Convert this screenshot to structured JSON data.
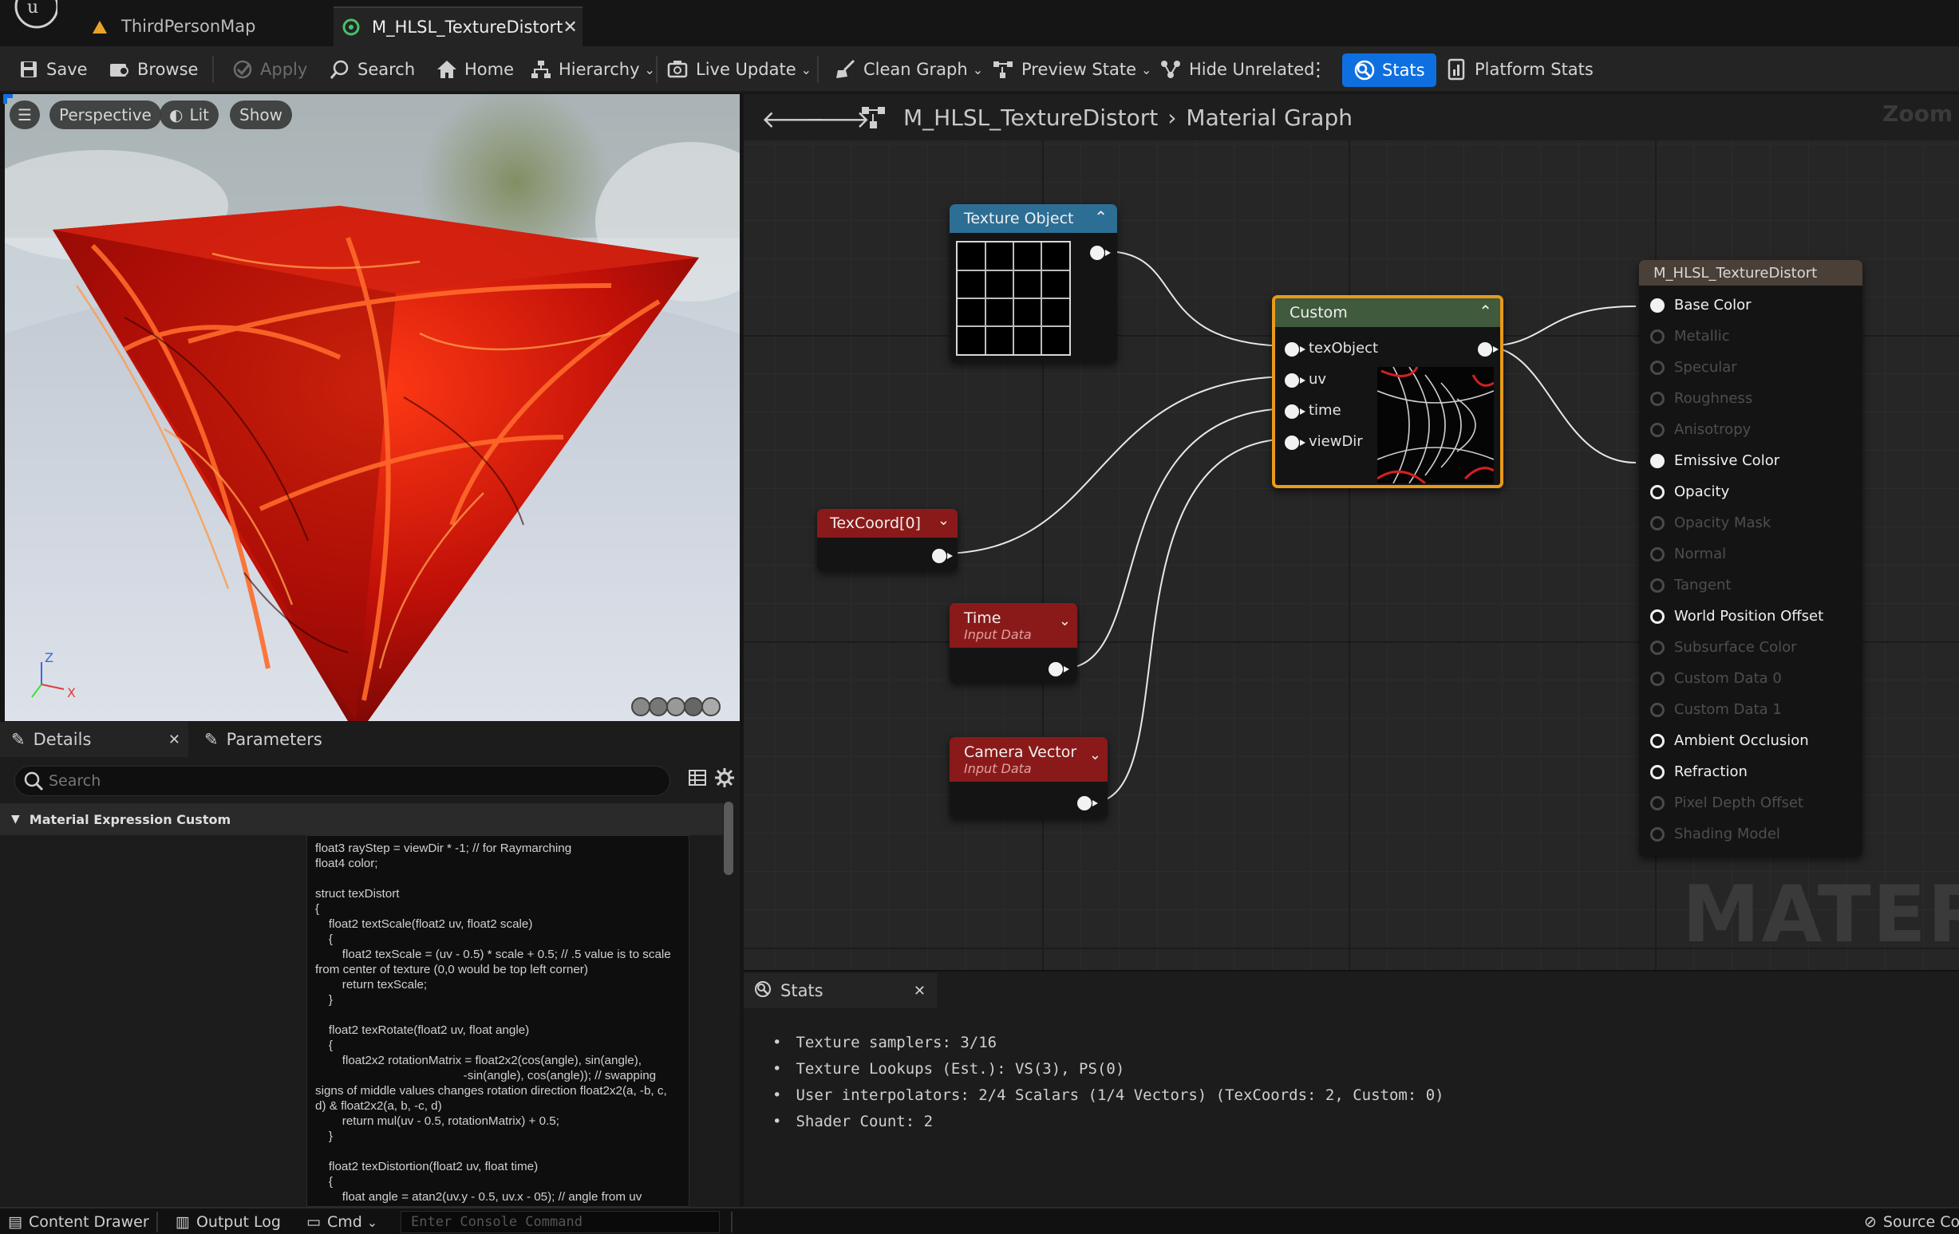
{
  "tabs": [
    {
      "label": "ThirdPersonMap",
      "icon": "map-icon"
    },
    {
      "label": "M_HLSL_TextureDistort",
      "icon": "material-icon",
      "active": true
    }
  ],
  "toolbar": {
    "save": "Save",
    "browse": "Browse",
    "apply": "Apply",
    "search": "Search",
    "home": "Home",
    "hierarchy": "Hierarchy",
    "live_update": "Live Update",
    "clean_graph": "Clean Graph",
    "preview_state": "Preview State",
    "hide_unrelated": "Hide Unrelated",
    "stats": "Stats",
    "platform_stats": "Platform Stats"
  },
  "viewport": {
    "perspective": "Perspective",
    "lit": "Lit",
    "show": "Show",
    "axis_x": "X",
    "axis_z": "Z"
  },
  "details": {
    "tab_details": "Details",
    "tab_parameters": "Parameters",
    "search_placeholder": "Search",
    "section": "Material Expression Custom",
    "code": "float3 rayStep = viewDir * -1; // for Raymarching\nfloat4 color;\n\nstruct texDistort\n{\n    float2 textScale(float2 uv, float2 scale)\n    {\n        float2 texScale = (uv - 0.5) * scale + 0.5; // .5 value is to scale from center of texture (0,0 would be top left corner)\n        return texScale;\n    }\n\n    float2 texRotate(float2 uv, float angle)\n    {\n        float2x2 rotationMatrix = float2x2(cos(angle), sin(angle),\n                                            -sin(angle), cos(angle)); // swapping signs of middle values changes rotation direction float2x2(a, -b, c, d) & float2x2(a, b, -c, d)\n        return mul(uv - 0.5, rotationMatrix) + 0.5;\n    }\n\n    float2 texDistortion(float2 uv, float time)\n    {\n        float angle = atan2(uv.y - 0.5, uv.x - 05); // angle from uv"
  },
  "graph": {
    "breadcrumb_asset": "M_HLSL_TextureDistort",
    "breadcrumb_graph": "Material Graph",
    "zoom": "Zoom",
    "watermark": "MATERIA",
    "nodes": {
      "texture_object": {
        "title": "Texture Object"
      },
      "custom": {
        "title": "Custom",
        "inputs": [
          "texObject",
          "uv",
          "time",
          "viewDir"
        ]
      },
      "texcoord": {
        "title": "TexCoord[0]"
      },
      "time": {
        "title": "Time",
        "subtitle": "Input Data"
      },
      "camera_vector": {
        "title": "Camera Vector",
        "subtitle": "Input Data"
      },
      "output": {
        "title": "M_HLSL_TextureDistort",
        "pins": [
          {
            "label": "Base Color",
            "active": true,
            "connected": true
          },
          {
            "label": "Metallic",
            "active": false
          },
          {
            "label": "Specular",
            "active": false
          },
          {
            "label": "Roughness",
            "active": false
          },
          {
            "label": "Anisotropy",
            "active": false
          },
          {
            "label": "Emissive Color",
            "active": true,
            "connected": true
          },
          {
            "label": "Opacity",
            "active": true
          },
          {
            "label": "Opacity Mask",
            "active": false
          },
          {
            "label": "Normal",
            "active": false
          },
          {
            "label": "Tangent",
            "active": false
          },
          {
            "label": "World Position Offset",
            "active": true
          },
          {
            "label": "Subsurface Color",
            "active": false
          },
          {
            "label": "Custom Data 0",
            "active": false
          },
          {
            "label": "Custom Data 1",
            "active": false
          },
          {
            "label": "Ambient Occlusion",
            "active": true
          },
          {
            "label": "Refraction",
            "active": true
          },
          {
            "label": "Pixel Depth Offset",
            "active": false
          },
          {
            "label": "Shading Model",
            "active": false
          }
        ]
      }
    }
  },
  "stats": {
    "tab": "Stats",
    "lines": [
      "Texture samplers: 3/16",
      "Texture Lookups (Est.): VS(3), PS(0)",
      "User interpolators: 2/4 Scalars (1/4 Vectors) (TexCoords: 2, Custom: 0)",
      "Shader Count: 2"
    ]
  },
  "bottom": {
    "content_drawer": "Content Drawer",
    "output_log": "Output Log",
    "cmd": "Cmd",
    "console_placeholder": "Enter Console Command",
    "source_control": "Source Co"
  },
  "colors": {
    "accent": "#0e6fe0",
    "custom_node_border": "#e89a1a",
    "texture_header": "#2d6e95",
    "input_node_header": "#8a1a1a",
    "custom_header": "#3f5a3c"
  }
}
